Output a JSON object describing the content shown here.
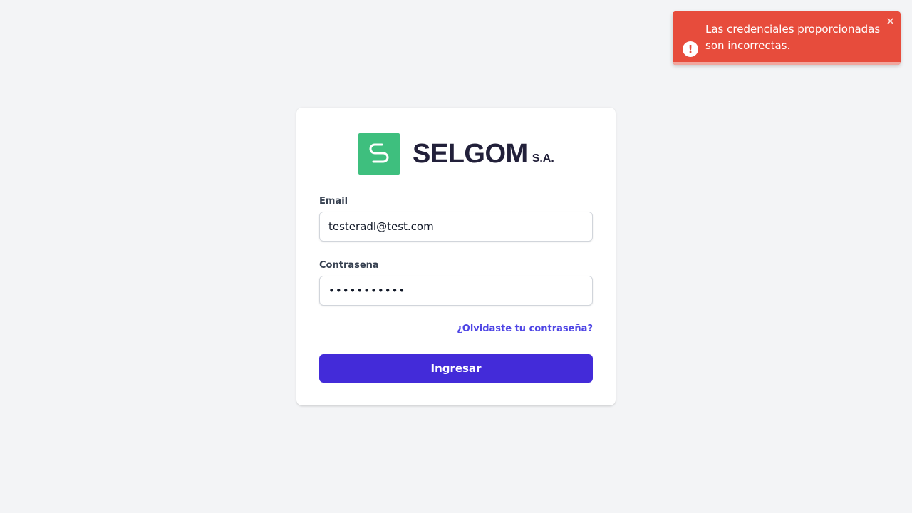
{
  "toast": {
    "icon": "exclamation-icon",
    "message": "Las credenciales proporcionadas son incorrectas.",
    "close_symbol": "✕",
    "close_icon": "close-icon",
    "color": "#e74c3c",
    "progress_fraction": 1.0
  },
  "logo": {
    "name": "SELGOM",
    "suffix": "S.A.",
    "mark_color": "#3ebf7e"
  },
  "form": {
    "email_label": "Email",
    "email_value": "testeradl@test.com",
    "password_label": "Contraseña",
    "password_value": "•••••••••••",
    "forgot_link": "¿Olvidaste tu contraseña?",
    "submit_label": "Ingresar",
    "accent_color": "#432bd9"
  }
}
